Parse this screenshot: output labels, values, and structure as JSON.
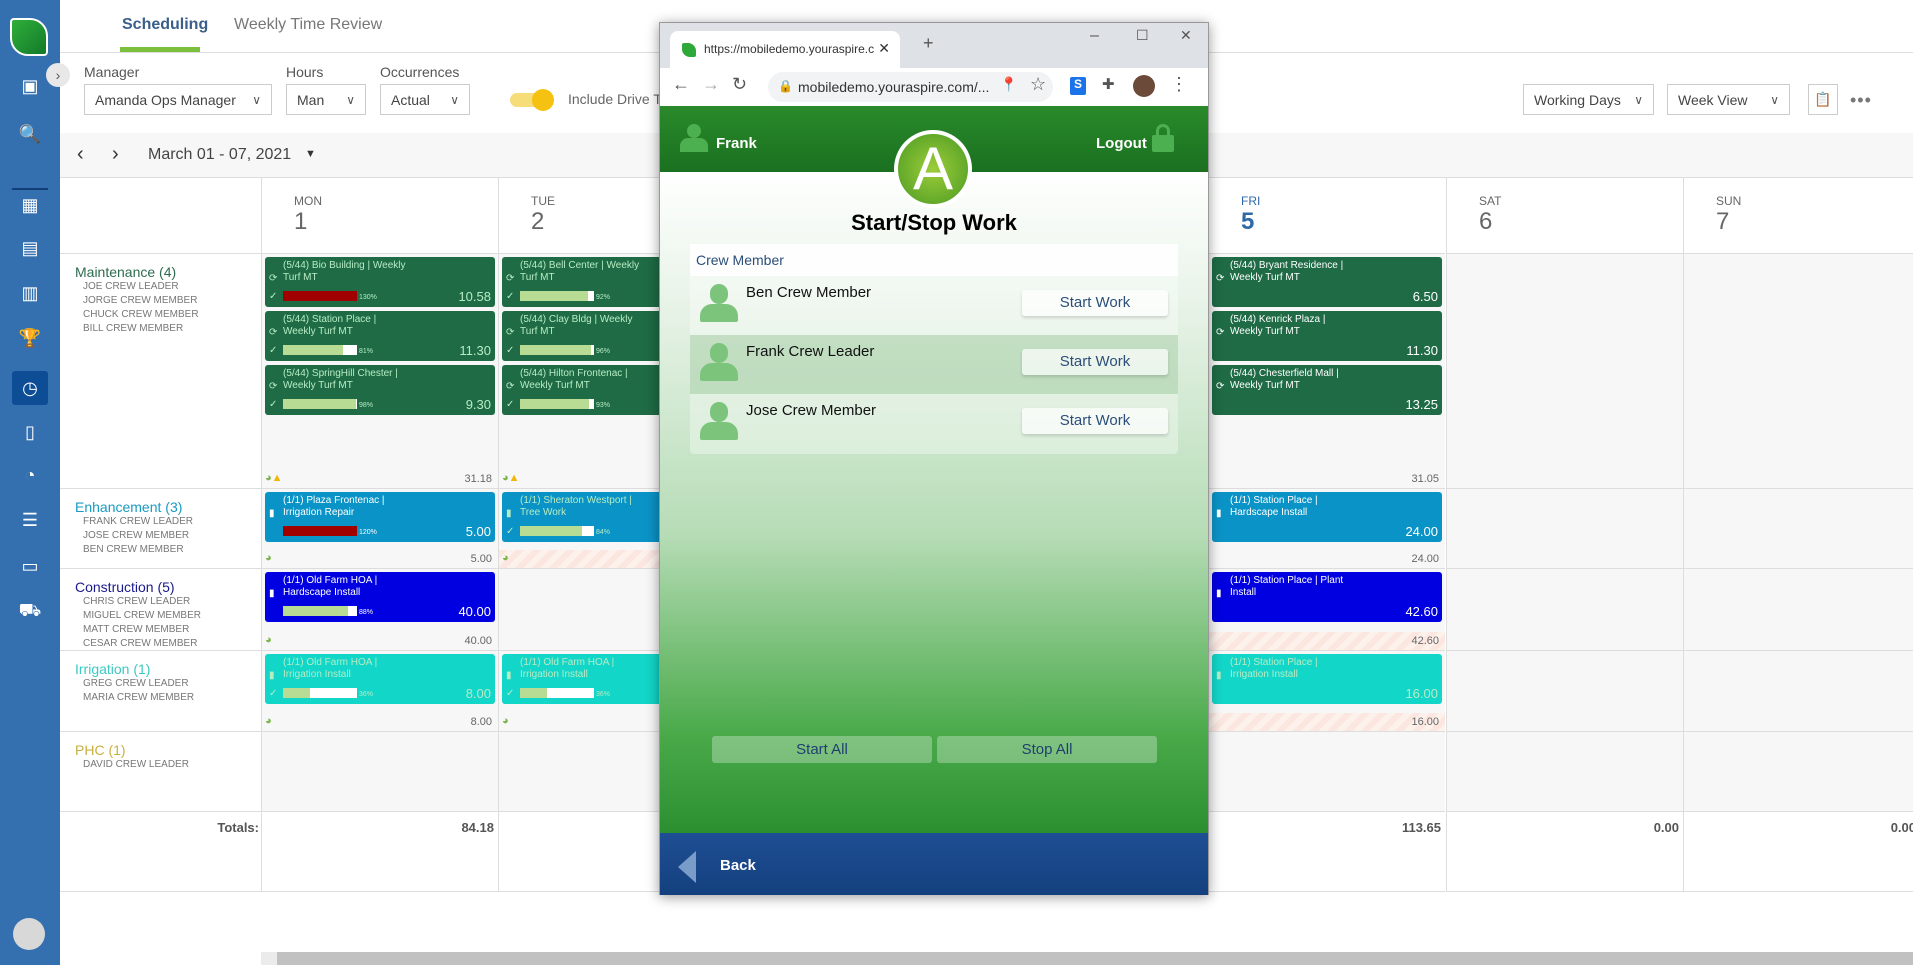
{
  "sidebar": {
    "icons": [
      "money-icon",
      "search-icon",
      "calendar-icon",
      "id-card-icon",
      "building-icon",
      "trophy-icon",
      "schedule-icon",
      "clipboard-icon",
      "pie-chart-icon",
      "receipt-icon",
      "inbox-icon",
      "tractor-icon"
    ],
    "active": "schedule-icon",
    "accent": "#3470b0"
  },
  "tabs": [
    {
      "label": "Scheduling",
      "active": true
    },
    {
      "label": "Weekly Time Review",
      "active": false
    }
  ],
  "filters": {
    "manager_label": "Manager",
    "manager_value": "Amanda Ops Manager",
    "hours_label": "Hours",
    "hours_value": "Man",
    "occ_label": "Occurrences",
    "occ_value": "Actual",
    "toggle_label": "Include Drive T",
    "toggle_on": true,
    "working_days": "Working Days",
    "view": "Week View"
  },
  "nav": {
    "range": "March 01 - 07, 2021"
  },
  "days": [
    {
      "dn": "MON",
      "dd": "1"
    },
    {
      "dn": "TUE",
      "dd": "2"
    },
    {
      "dn": "",
      "dd": ""
    },
    {
      "dn": "",
      "dd": ""
    },
    {
      "dn": "FRI",
      "dd": "5",
      "today": true
    },
    {
      "dn": "SAT",
      "dd": "6"
    },
    {
      "dn": "SUN",
      "dd": "7"
    }
  ],
  "groups": [
    {
      "name": "Maintenance (4)",
      "color": "#2e6b50",
      "card_color": "#1e6b45",
      "members": [
        "JOE CREW LEADER",
        "JORGE CREW MEMBER",
        "CHUCK CREW MEMBER",
        "BILL CREW MEMBER"
      ],
      "cells": [
        {
          "total": "31.18",
          "icons": [
            "green",
            "warn"
          ],
          "cards": [
            {
              "title": "(5/44) Bio Building | Weekly Turf MT",
              "icon": "recurring",
              "check": true,
              "pct": 130,
              "pct_label": "130%",
              "hours": "10.58",
              "dim": true
            },
            {
              "title": "(5/44) Station Place | Weekly Turf MT",
              "icon": "recurring",
              "check": true,
              "pct": 81,
              "pct_label": "81%",
              "hours": "11.30",
              "dim": true
            },
            {
              "title": "(5/44) SpringHill Chester | Weekly Turf MT",
              "icon": "recurring",
              "check": true,
              "pct": 98,
              "pct_label": "98%",
              "hours": "9.30",
              "dim": true
            }
          ]
        },
        {
          "total": "",
          "icons": [
            "green",
            "warn"
          ],
          "cards": [
            {
              "title": "(5/44) Bell Center | Weekly Turf MT",
              "icon": "recurring",
              "check": true,
              "pct": 92,
              "pct_label": "92%",
              "dim": true
            },
            {
              "title": "(5/44) Clay Bldg | Weekly Turf MT",
              "icon": "recurring",
              "check": true,
              "pct": 96,
              "pct_label": "96%",
              "dim": true
            },
            {
              "title": "(5/44) Hilton Frontenac | Weekly Turf MT",
              "icon": "recurring",
              "check": true,
              "pct": 93,
              "pct_label": "93%",
              "dim": true
            }
          ]
        },
        null,
        null,
        {
          "total": "31.05",
          "icons": [],
          "cards": [
            {
              "title": "(5/44) Bryant Residence | Weekly Turf MT",
              "icon": "recurring",
              "hours": "6.50"
            },
            {
              "title": "(5/44) Kenrick Plaza | Weekly Turf MT",
              "icon": "recurring",
              "hours": "11.30"
            },
            {
              "title": "(5/44) Chesterfield Mall | Weekly Turf MT",
              "icon": "recurring",
              "hours": "13.25"
            }
          ]
        },
        {
          "cards": []
        },
        {
          "cards": []
        }
      ]
    },
    {
      "name": "Enhancement (3)",
      "color": "#1a9ac0",
      "card_color": "#0a93c6",
      "members": [
        "FRANK CREW LEADER",
        "JOSE CREW MEMBER",
        "BEN CREW MEMBER"
      ],
      "cells": [
        {
          "total": "5.00",
          "icons": [
            "green"
          ],
          "cards": [
            {
              "title": "(1/1) Plaza Frontenac | Irrigation Repair",
              "icon": "clipboard",
              "pct": 120,
              "pct_label": "120%",
              "hours": "5.00"
            }
          ]
        },
        {
          "total": "",
          "icons": [
            "green"
          ],
          "hatch": true,
          "cards": [
            {
              "title": "(1/1) Sheraton Westport | Tree Work",
              "icon": "clipboard",
              "check": true,
              "pct": 84,
              "pct_label": "84%",
              "dim": true
            }
          ]
        },
        null,
        null,
        {
          "total": "24.00",
          "icons": [],
          "cards": [
            {
              "title": "(1/1) Station Place | Hardscape Install",
              "icon": "clipboard",
              "hours": "24.00"
            }
          ]
        },
        {
          "cards": []
        },
        {
          "cards": []
        }
      ]
    },
    {
      "name": "Construction (5)",
      "color": "#1a1a8c",
      "card_color": "#0000e0",
      "members": [
        "CHRIS CREW LEADER",
        "MIGUEL CREW MEMBER",
        "MATT CREW MEMBER",
        "CESAR CREW MEMBER"
      ],
      "cells": [
        {
          "total": "40.00",
          "icons": [
            "green"
          ],
          "cards": [
            {
              "title": "(1/1) Old Farm HOA | Hardscape Install",
              "icon": "clipboard",
              "pct": 88,
              "pct_label": "88%",
              "hours": "40.00"
            }
          ]
        },
        {
          "cards": []
        },
        null,
        null,
        {
          "total": "42.60",
          "icons": [],
          "hatch": true,
          "cards": [
            {
              "title": "(1/1) Station Place | Plant Install",
              "icon": "clipboard",
              "hours": "42.60"
            }
          ]
        },
        {
          "cards": []
        },
        {
          "cards": []
        }
      ]
    },
    {
      "name": "Irrigation (1)",
      "color": "#3cc8c0",
      "card_color": "#12d6c8",
      "members": [
        "GREG CREW LEADER",
        "MARIA CREW MEMBER"
      ],
      "cells": [
        {
          "total": "8.00",
          "icons": [
            "green"
          ],
          "cards": [
            {
              "title": "(1/1) Old Farm HOA | Irrigation Install",
              "icon": "clipboard",
              "check": true,
              "pct": 36,
              "pct_label": "36%",
              "hours": "8.00",
              "dim": true
            }
          ]
        },
        {
          "total": "",
          "icons": [
            "green"
          ],
          "cards": [
            {
              "title": "(1/1) Old Farm HOA | Irrigation Install",
              "icon": "clipboard",
              "check": true,
              "pct": 36,
              "pct_label": "36%",
              "dim": true
            }
          ]
        },
        null,
        null,
        {
          "total": "16.00",
          "icons": [],
          "hatch": true,
          "cards": [
            {
              "title": "(1/1) Station Place | Irrigation Install",
              "icon": "clipboard",
              "hours": "16.00",
              "dim": true
            }
          ]
        },
        {
          "cards": []
        },
        {
          "cards": []
        }
      ]
    },
    {
      "name": "PHC (1)",
      "color": "#c8b040",
      "members": [
        "DAVID CREW LEADER"
      ],
      "cells": [
        {
          "cards": []
        },
        {
          "cards": []
        },
        null,
        null,
        {
          "cards": []
        },
        {
          "cards": []
        },
        {
          "cards": []
        }
      ]
    }
  ],
  "totals": {
    "label": "Totals:",
    "values": [
      "84.18",
      "",
      "",
      "",
      "113.65",
      "0.00",
      "0.00"
    ]
  },
  "popup": {
    "tab_title": "https://mobiledemo.youraspire.c",
    "url": "mobiledemo.youraspire.com/...",
    "user": "Frank",
    "logout": "Logout",
    "logo_letter": "A",
    "title": "Start/Stop Work",
    "list_header": "Crew Member",
    "crew": [
      {
        "name": "Ben Crew Member",
        "action": "Start Work"
      },
      {
        "name": "Frank Crew Leader",
        "action": "Start Work",
        "highlighted": true
      },
      {
        "name": "Jose Crew Member",
        "action": "Start Work"
      }
    ],
    "start_all": "Start All",
    "stop_all": "Stop All",
    "back": "Back"
  }
}
